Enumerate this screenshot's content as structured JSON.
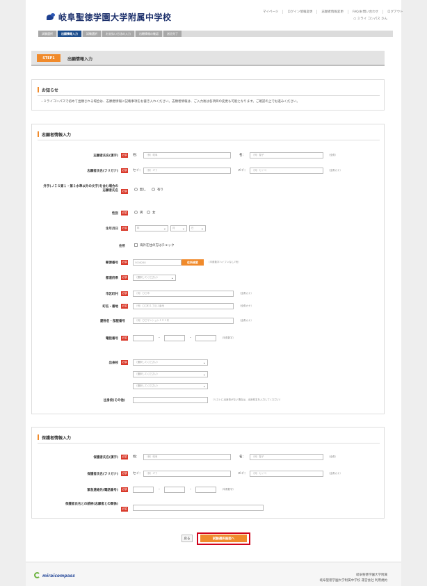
{
  "header": {
    "school_name": "岐阜聖徳学園大学附属中学校",
    "nav": [
      "マイページ",
      "ログイン情報変更",
      "志願者情報変更",
      "FAQ/お問い合わせ",
      "ログアウト"
    ],
    "user": "○ ミライ コンパス さん"
  },
  "steps": [
    "試験選択",
    "出願情報入力",
    "試験選択",
    "お支払い方法の入力",
    "出願情報の確認",
    "送信完了"
  ],
  "title": {
    "badge": "STEP1",
    "text": "出願情報入力"
  },
  "notice": {
    "heading": "お知らせ",
    "text": "・ミライコンパスで初めて出願される場合は、志願者情報に記載事項をお書き入れください。志願者情報は、ご入力後は各項目の変更も可能となります。ご確認の上でお進みください。"
  },
  "applicant": {
    "heading": "志願者情報入力",
    "req": "必須",
    "name_kanji_label": "志願者氏名(漢字)",
    "name_kana_label": "志願者氏名(フリガナ)",
    "sei": "姓：",
    "mei": "名：",
    "sei_kana": "セイ：",
    "mei_kana": "メイ：",
    "sei_ph": "（例）岐阜",
    "mei_ph": "（例）聖子",
    "sei_kana_ph": "（例）ギフ",
    "mei_kana_ph": "（例）セイコ",
    "name_hint": "（全角）",
    "kana_hint": "（全角カナ）",
    "gaiji_label": "外字(ＪＩＳ第１・第２水準以外の文字)を含む場合の志願者氏名",
    "gaiji_no": "無し",
    "gaiji_yes": "有り",
    "gender_label": "性別",
    "male": "男",
    "female": "女",
    "dob_label": "生年月日",
    "dob_year": "年",
    "dob_month": "月",
    "dob_day": "日",
    "address_label": "住所",
    "overseas": "海外在住の方はチェック",
    "zip_label": "郵便番号",
    "zip_ph": "5008288",
    "zip_btn": "住所検索",
    "zip_hint": "（半角数字ハイフンなし7桁）",
    "pref_label": "都道府県",
    "pref_ph": "（選択してください）",
    "city_label": "市区町村",
    "city_ph": "（例）〇〇市",
    "town_label": "町名・番地",
    "town_ph": "（例）〇〇町１丁目１番地",
    "bldg_label": "建物名・部屋番号",
    "bldg_ph": "（例）〇〇マンション１０１号",
    "tel_label": "電話番号",
    "tel_hint": "（半角数字）",
    "school_label": "出身校",
    "school_ph": "（選択してください）",
    "school_other_label": "出身校(その他)",
    "school_other_hint": "（リストに出身校がない場合は、出身校名を入力してください）"
  },
  "guardian": {
    "heading": "保護者情報入力",
    "name_kanji_label": "保護者氏名(漢字)",
    "name_kana_label": "保護者氏名(フリガナ)",
    "tel_label": "緊急連絡先(電話番号)",
    "relation_label": "保護者氏名との続柄(志願者との関係)",
    "relation_ph": ""
  },
  "actions": {
    "back": "戻る",
    "next": "試験選択画面へ"
  },
  "footer": {
    "logo": "miraicompass",
    "line1": "岐阜聖徳学園大学附属",
    "line2": "岐阜聖徳学園大学附属中学校 運営会社 利用規約"
  }
}
